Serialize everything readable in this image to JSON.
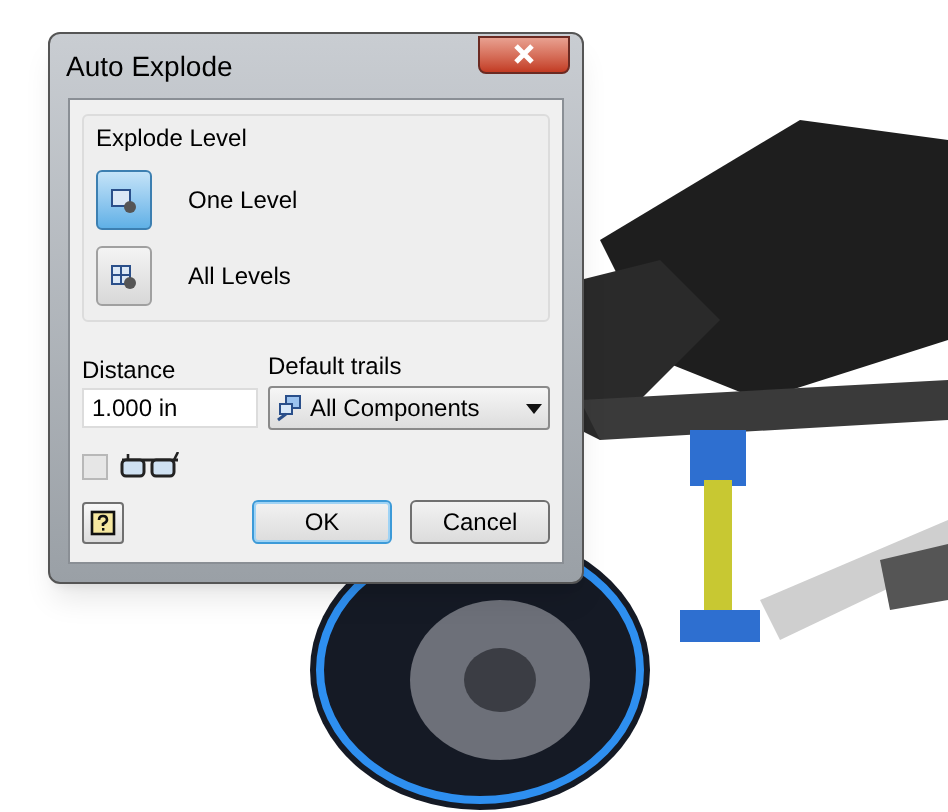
{
  "window": {
    "title": "Auto Explode"
  },
  "explode_level": {
    "title": "Explode Level",
    "options": [
      {
        "label": "One Level",
        "selected": true
      },
      {
        "label": "All Levels",
        "selected": false
      }
    ]
  },
  "distance": {
    "label": "Distance",
    "value": "1.000 in"
  },
  "default_trails": {
    "label": "Default trails",
    "value": "All Components"
  },
  "trails_checkbox": {
    "checked": false
  },
  "buttons": [
    {
      "label": "OK",
      "focused": true
    },
    {
      "label": "Cancel",
      "focused": false
    }
  ]
}
